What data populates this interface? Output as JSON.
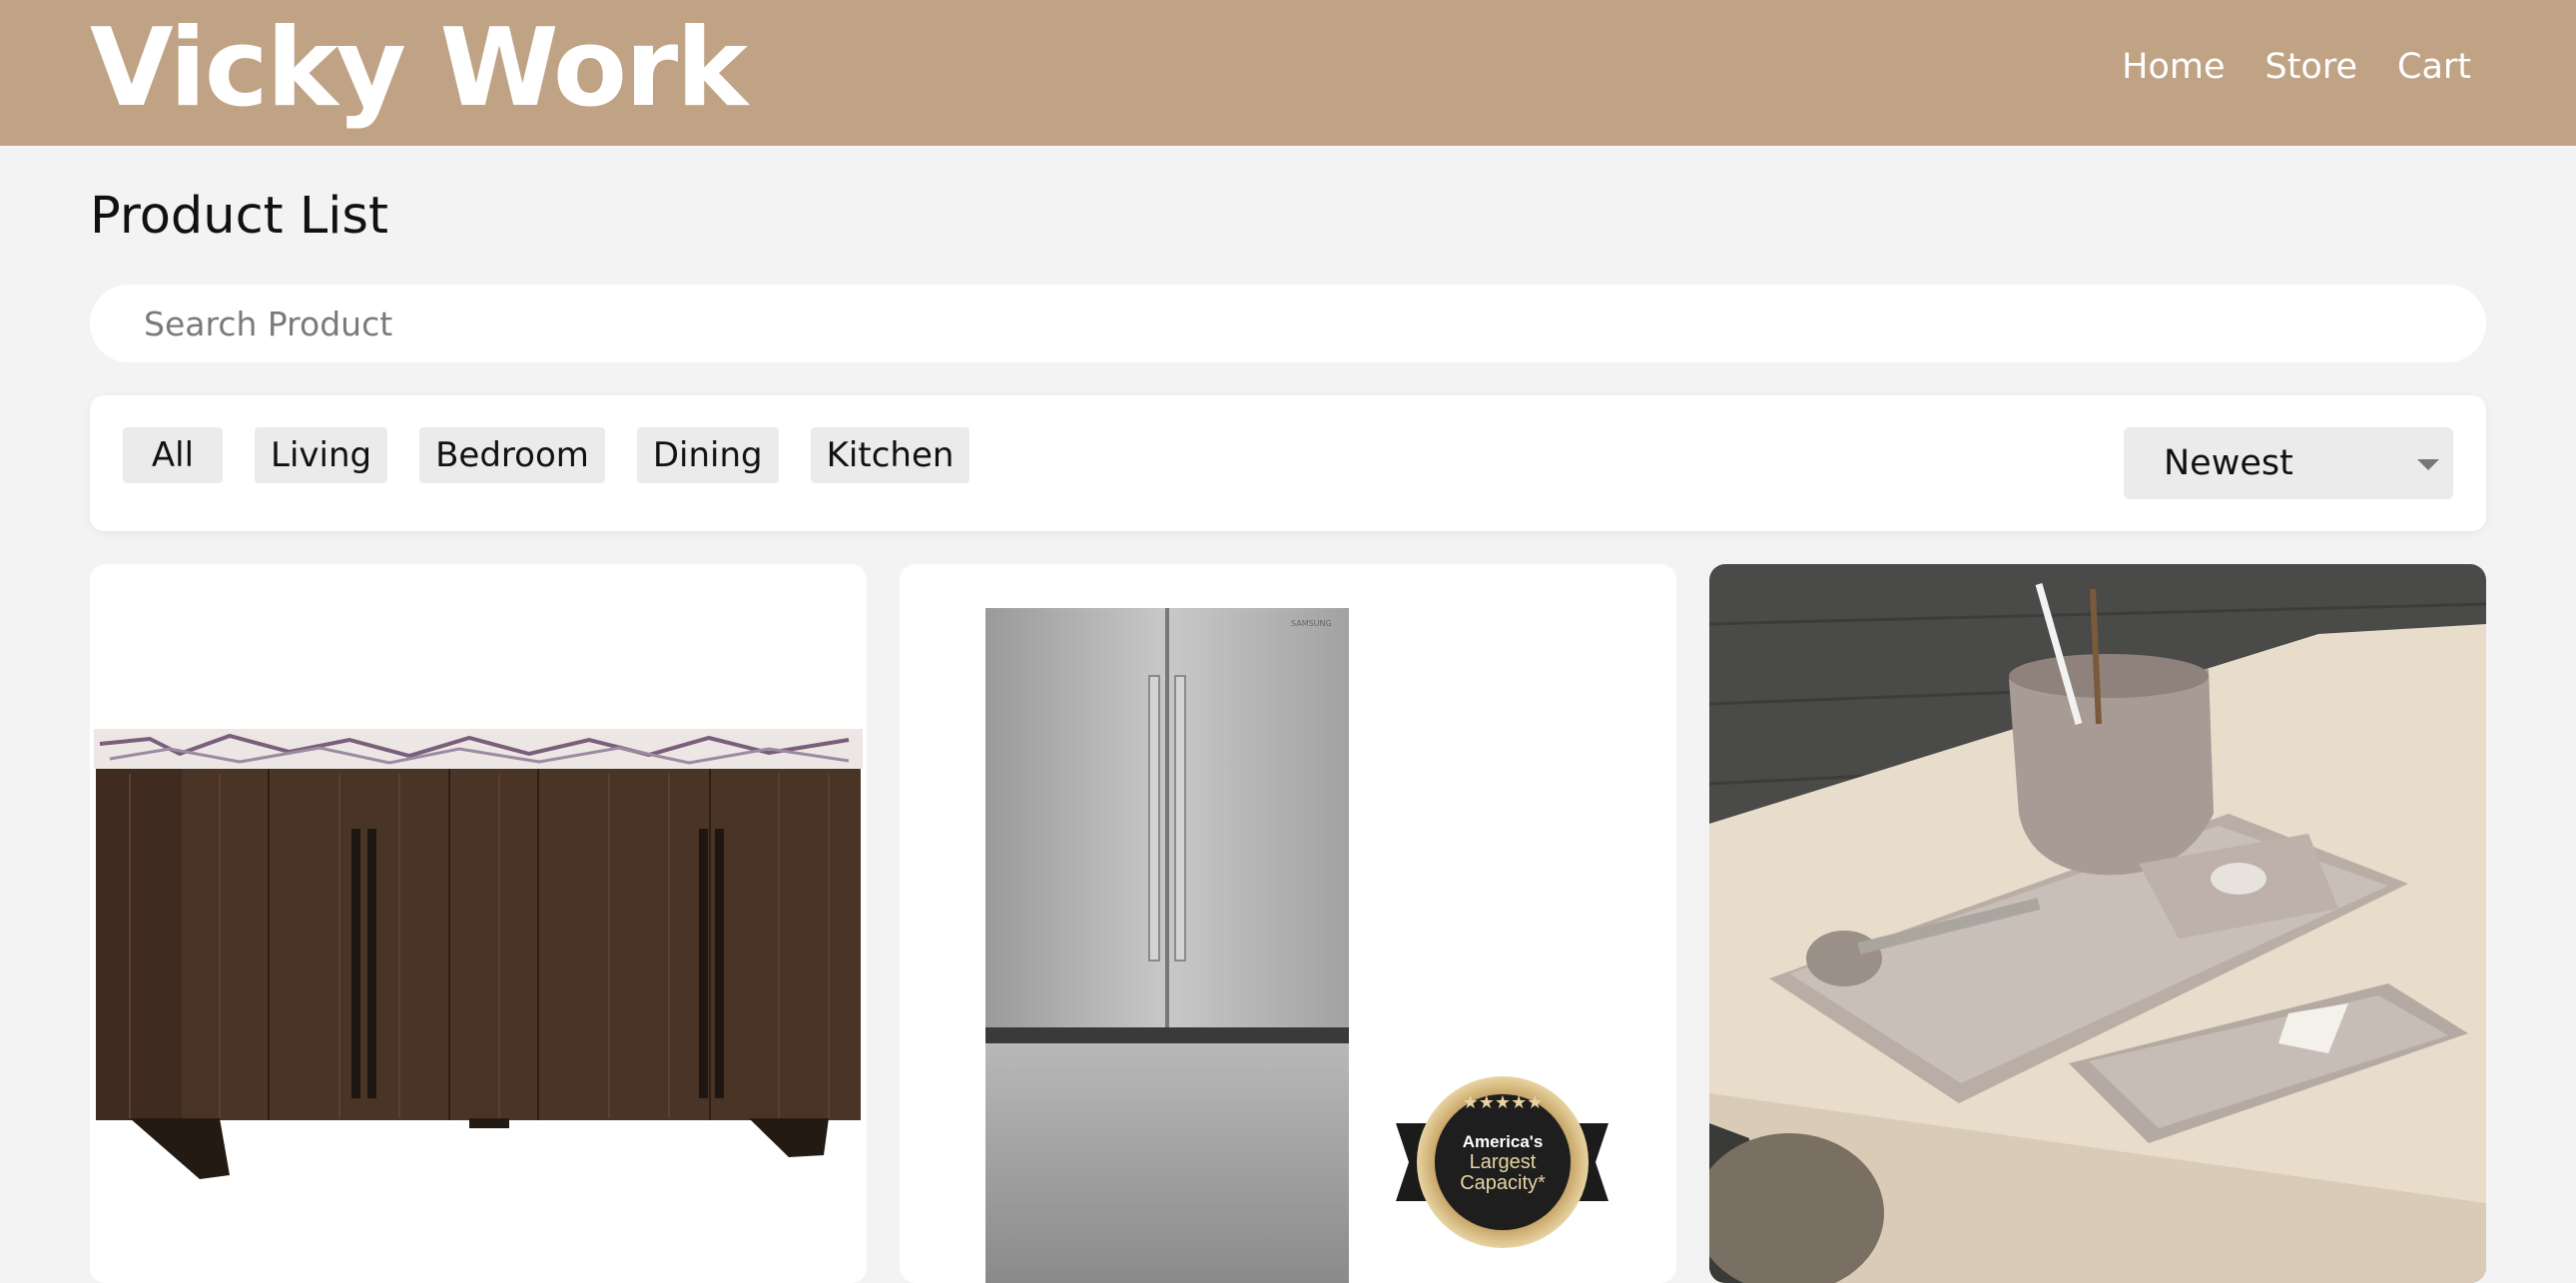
{
  "header": {
    "brand": "Vicky Work",
    "nav": [
      {
        "label": "Home"
      },
      {
        "label": "Store"
      },
      {
        "label": "Cart"
      }
    ]
  },
  "page": {
    "title": "Product List"
  },
  "search": {
    "placeholder": "Search Product",
    "value": ""
  },
  "filters": {
    "categories": [
      {
        "label": "All"
      },
      {
        "label": "Living"
      },
      {
        "label": "Bedroom"
      },
      {
        "label": "Dining"
      },
      {
        "label": "Kitchen"
      }
    ],
    "sort": {
      "selected": "Newest"
    }
  },
  "products": [
    {
      "image": "sideboard-image"
    },
    {
      "image": "refrigerator-image",
      "badge": {
        "line1": "America's",
        "line2": "Largest",
        "line3": "Capacity*"
      }
    },
    {
      "image": "desk-organizer-image"
    }
  ],
  "colors": {
    "header_bg": "#c0a385",
    "page_bg": "#f3f3f3",
    "chip_bg": "#ebebeb"
  }
}
